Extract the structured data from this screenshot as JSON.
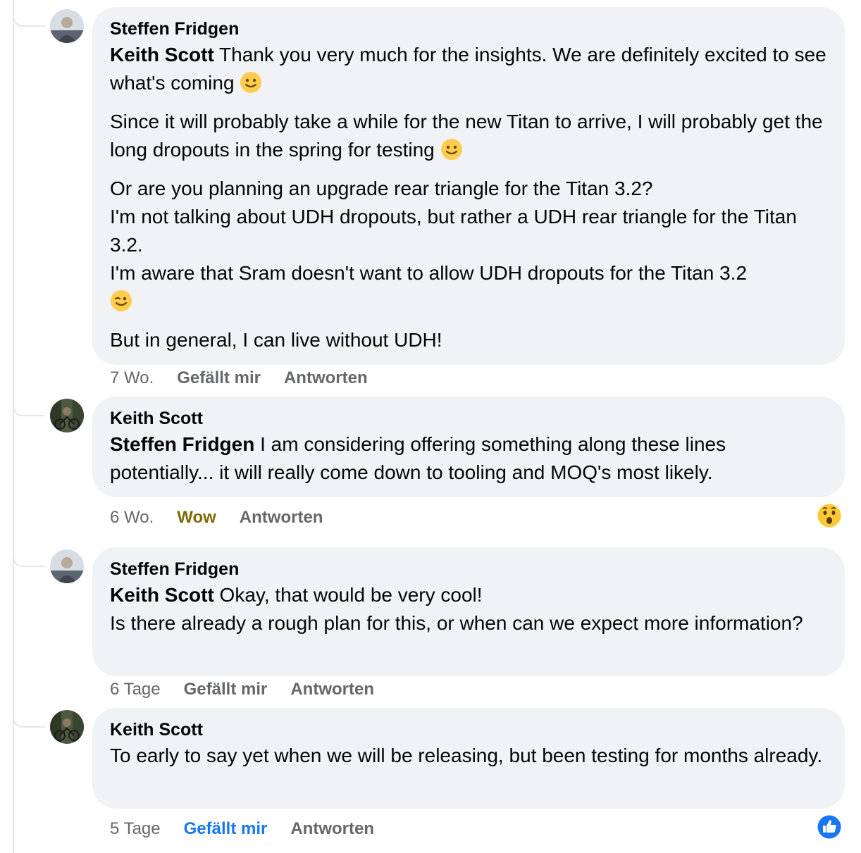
{
  "comments": [
    {
      "author": "Steffen Fridgen",
      "mention": "Keith Scott",
      "p1_rest": " Thank you very much for the insights. We are definitely excited to see what's coming",
      "p2": "Since it will probably take a while for the new Titan to arrive, I will probably get the long dropouts in the spring for testing",
      "p3_l1": "Or are you planning an upgrade rear triangle for the Titan 3.2?",
      "p3_l2": "I'm not talking about UDH dropouts, but rather a UDH rear triangle for the Titan 3.2.",
      "p3_l3": "I'm aware that Sram doesn't want to allow UDH dropouts for the Titan 3.2",
      "p4": "But in general, I can live without UDH!",
      "time": "7 Wo.",
      "like": "Gefällt mir",
      "reply": "Antworten"
    },
    {
      "author": "Keith Scott",
      "mention": "Steffen Fridgen",
      "text": " I am considering offering something along these lines potentially... it will really come down to tooling and MOQ's most likely.",
      "time": "6 Wo.",
      "like": "Wow",
      "reply": "Antworten",
      "reaction_icon": "wow-emoji-icon"
    },
    {
      "author": "Steffen Fridgen",
      "mention": "Keith Scott",
      "l1_rest": " Okay, that would be very cool!",
      "l2": "Is there already a rough plan for this, or when can we expect more information?",
      "time": "6 Tage",
      "like": "Gefällt mir",
      "reply": "Antworten"
    },
    {
      "author": "Keith Scott",
      "text": "To early to say yet when we will be releasing, but been testing for months already.",
      "time": "5 Tage",
      "like": "Gefällt mir",
      "reply": "Antworten",
      "reaction_icon": "like-thumb-icon"
    }
  ],
  "colors": {
    "bubble": "#f0f2f5",
    "meta": "#65676b",
    "liked": "#1877f2",
    "wow": "#7d6a06",
    "thread_line": "#e4e6eb"
  }
}
